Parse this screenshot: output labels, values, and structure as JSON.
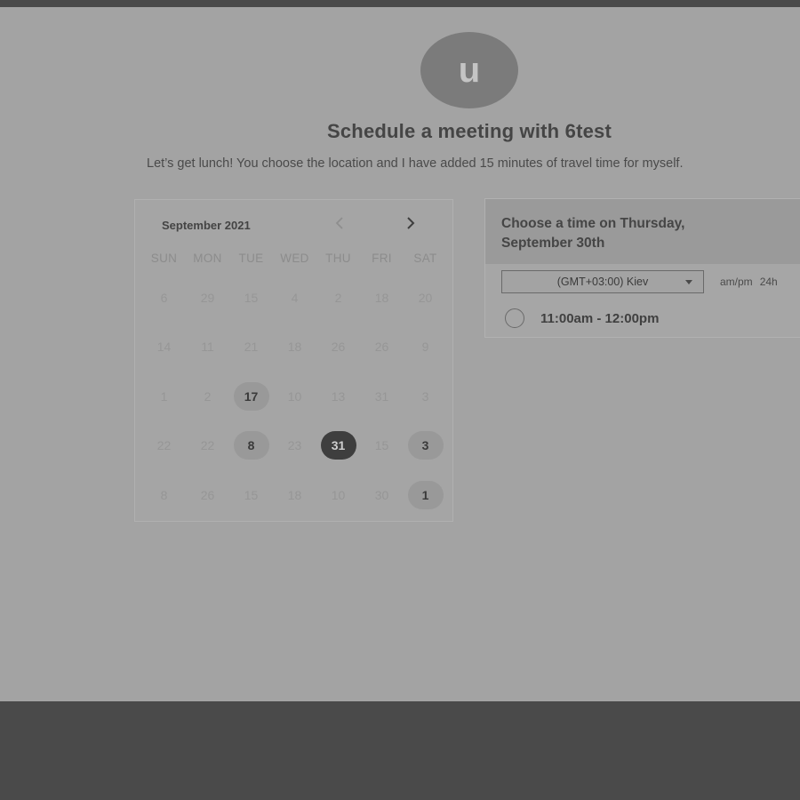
{
  "header": {
    "avatar_letter": "u",
    "title": "Schedule a meeting with 6test",
    "subtitle": "Let’s get lunch! You choose the location and I have added 15 minutes of travel time for myself."
  },
  "calendar": {
    "month_label": "September 2021",
    "weekdays": [
      "SUN",
      "MON",
      "TUE",
      "WED",
      "THU",
      "FRI",
      "SAT"
    ],
    "weeks": [
      [
        {
          "d": "6",
          "s": "muted"
        },
        {
          "d": "29",
          "s": "muted"
        },
        {
          "d": "15",
          "s": "muted"
        },
        {
          "d": "4",
          "s": "muted"
        },
        {
          "d": "2",
          "s": "muted"
        },
        {
          "d": "18",
          "s": "muted"
        },
        {
          "d": "20",
          "s": "muted"
        }
      ],
      [
        {
          "d": "14",
          "s": "muted"
        },
        {
          "d": "11",
          "s": "muted"
        },
        {
          "d": "21",
          "s": "muted"
        },
        {
          "d": "18",
          "s": "muted"
        },
        {
          "d": "26",
          "s": "muted"
        },
        {
          "d": "26",
          "s": "muted"
        },
        {
          "d": "9",
          "s": "muted"
        }
      ],
      [
        {
          "d": "1",
          "s": "muted"
        },
        {
          "d": "2",
          "s": "muted"
        },
        {
          "d": "17",
          "s": "available"
        },
        {
          "d": "10",
          "s": "muted"
        },
        {
          "d": "13",
          "s": "muted"
        },
        {
          "d": "31",
          "s": "muted"
        },
        {
          "d": "3",
          "s": "muted"
        }
      ],
      [
        {
          "d": "22",
          "s": "muted"
        },
        {
          "d": "22",
          "s": "muted"
        },
        {
          "d": "8",
          "s": "available"
        },
        {
          "d": "23",
          "s": "muted"
        },
        {
          "d": "31",
          "s": "selected"
        },
        {
          "d": "15",
          "s": "muted"
        },
        {
          "d": "3",
          "s": "available"
        }
      ],
      [
        {
          "d": "8",
          "s": "muted"
        },
        {
          "d": "26",
          "s": "muted"
        },
        {
          "d": "15",
          "s": "muted"
        },
        {
          "d": "18",
          "s": "muted"
        },
        {
          "d": "10",
          "s": "muted"
        },
        {
          "d": "30",
          "s": "muted"
        },
        {
          "d": "1",
          "s": "available"
        }
      ]
    ]
  },
  "time_panel": {
    "title": "Choose a time on Thursday, September 30th",
    "timezone": "(GMT+03:00) Kiev",
    "format_ampm": "am/pm",
    "format_24h": "24h",
    "slots": [
      "11:00am - 12:00pm"
    ]
  },
  "icons": {
    "prev": "chevron-left-icon",
    "next": "chevron-right-icon",
    "caret": "caret-down-icon"
  },
  "colors": {
    "overlay_page": "#a3a3a3",
    "selected_day": "#3e3e3e",
    "available_day": "#999999"
  }
}
